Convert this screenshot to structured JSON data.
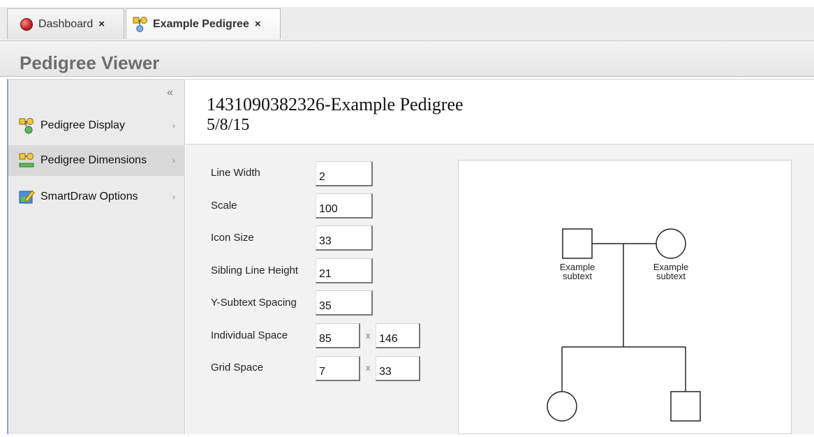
{
  "tabs": [
    {
      "label": "Dashboard",
      "close": "×",
      "icon": "red-circle-icon"
    },
    {
      "label": "Example Pedigree",
      "close": "×",
      "icon": "pedigree-icon"
    }
  ],
  "viewer": {
    "title": "Pedigree Viewer"
  },
  "sidebar": {
    "collapse": "«",
    "items": [
      {
        "label": "Pedigree Display",
        "icon": "pedigree-display-icon",
        "arrow": "›"
      },
      {
        "label": "Pedigree Dimensions",
        "icon": "pedigree-dimensions-icon",
        "arrow": "›"
      },
      {
        "label": "SmartDraw Options",
        "icon": "smartdraw-options-icon",
        "arrow": "›"
      }
    ]
  },
  "pedigree": {
    "name": "1431090382326-Example Pedigree",
    "date": "5/8/15"
  },
  "dimensions": {
    "line_width": {
      "label": "Line Width",
      "value": "2"
    },
    "scale": {
      "label": "Scale",
      "value": "100"
    },
    "icon_size": {
      "label": "Icon Size",
      "value": "33"
    },
    "sibling_line_height": {
      "label": "Sibling Line Height",
      "value": "21"
    },
    "y_subtext_spacing": {
      "label": "Y-Subtext Spacing",
      "value": "35"
    },
    "individual_space": {
      "label": "Individual Space",
      "x": "85",
      "sep": "x",
      "y": "146"
    },
    "grid_space": {
      "label": "Grid Space",
      "x": "7",
      "sep": "x",
      "y": "33"
    }
  },
  "preview": {
    "father_label_1": "Example",
    "father_label_2": "subtext",
    "mother_label_1": "Example",
    "mother_label_2": "subtext"
  },
  "colors": {
    "accent": "#7fa6d6",
    "dashboard_icon": "#c62828"
  }
}
